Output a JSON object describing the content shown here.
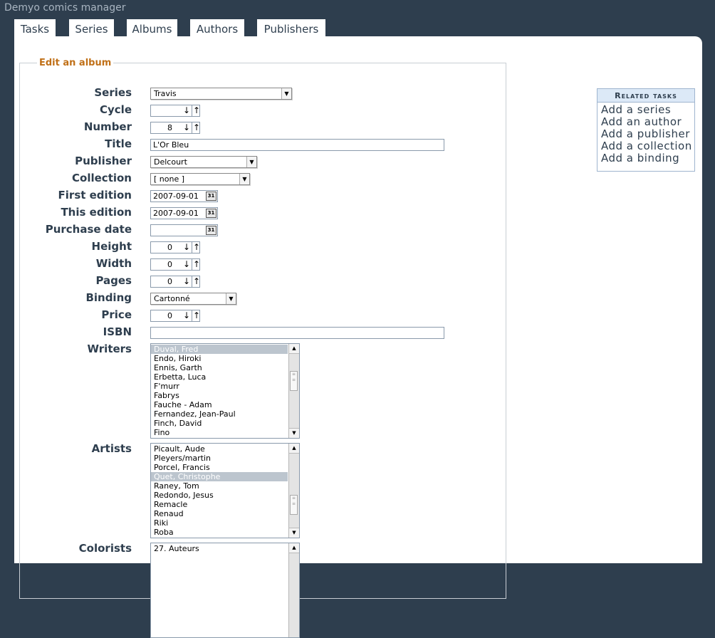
{
  "app": {
    "title": "Demyo comics manager"
  },
  "tabs": [
    {
      "label": "Tasks"
    },
    {
      "label": "Series"
    },
    {
      "label": "Albums"
    },
    {
      "label": "Authors"
    },
    {
      "label": "Publishers"
    }
  ],
  "form": {
    "legend": "Edit an album",
    "labels": {
      "series": "Series",
      "cycle": "Cycle",
      "number": "Number",
      "title": "Title",
      "publisher": "Publisher",
      "collection": "Collection",
      "first_edition": "First edition",
      "this_edition": "This edition",
      "purchase_date": "Purchase date",
      "height": "Height",
      "width": "Width",
      "pages": "Pages",
      "binding": "Binding",
      "price": "Price",
      "isbn": "ISBN",
      "writers": "Writers",
      "artists": "Artists",
      "colorists": "Colorists"
    },
    "values": {
      "series": "Travis",
      "cycle": "",
      "number": "8",
      "title": "L'Or Bleu",
      "publisher": "Delcourt",
      "collection": "[ none ]",
      "first_edition": "2007-09-01",
      "this_edition": "2007-09-01",
      "purchase_date": "",
      "height": "0",
      "width": "0",
      "pages": "0",
      "binding": "Cartonné",
      "price": "0",
      "isbn": ""
    },
    "spin_down": "↓",
    "spin_up": "↑",
    "calendar_glyph": "31",
    "select_arrow": "▼",
    "writers": {
      "items": [
        "Duval, Fred",
        "Endo, Hiroki",
        "Ennis, Garth",
        "Erbetta, Luca",
        "F'murr",
        "Fabrys",
        "Fauche - Adam",
        "Fernandez, Jean-Paul",
        "Finch, David",
        "Fino"
      ],
      "selected": "Duval, Fred"
    },
    "artists": {
      "items": [
        "Picault, Aude",
        "Pleyers/martin",
        "Porcel, Francis",
        "Quet, Christophe",
        "Raney, Tom",
        "Redondo, Jesus",
        "Remacle",
        "Renaud",
        "Riki",
        "Roba"
      ],
      "selected": "Quet, Christophe"
    },
    "colorists": {
      "items": [
        "27. Auteurs"
      ]
    }
  },
  "related": {
    "heading": "Related tasks",
    "links": [
      "Add a series",
      "Add an author",
      "Add a publisher",
      "Add a collection",
      "Add a binding"
    ]
  }
}
